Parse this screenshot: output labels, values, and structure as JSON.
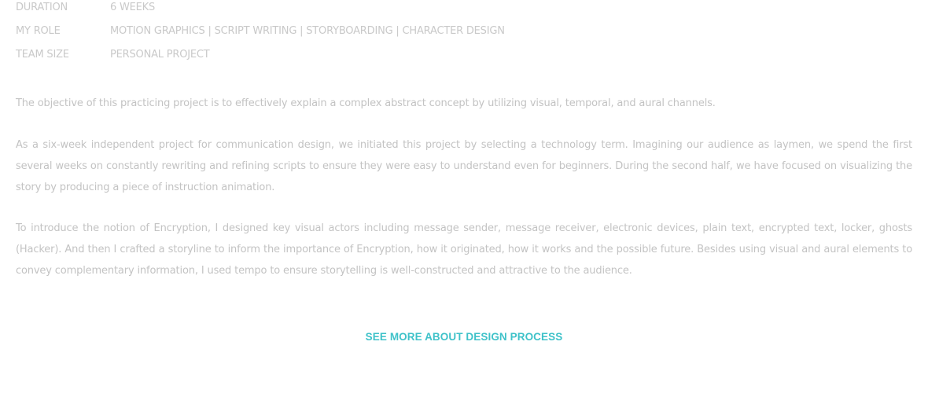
{
  "project_meta": [
    {
      "label": "DURATION",
      "value": "6 WEEKS"
    },
    {
      "label": "MY ROLE",
      "value": "MOTION GRAPHICS | SCRIPT WRITING | STORYBOARDING | CHARACTER DESIGN"
    },
    {
      "label": "TEAM SIZE",
      "value": "PERSONAL PROJECT"
    }
  ],
  "paragraphs": [
    "The objective of this practicing project is to effectively explain a complex abstract concept by utilizing visual, temporal, and aural channels.",
    "As a six-week independent project for communication design, we initiated this project by selecting a technology term. Imagining our audience as laymen, we spend the first several weeks on constantly rewriting and refining scripts to ensure they were easy to understand even for beginners. During the second half, we have focused on visualizing the story by producing a piece of instruction animation.",
    "To introduce the notion of Encryption, I designed key visual actors including message sender, message receiver, electronic devices, plain text, encrypted text, locker, ghosts (Hacker). And then I crafted a storyline to inform the importance of Encryption, how it originated, how it works and the possible future. Besides using visual and aural elements to convey complementary information, I used tempo to ensure storytelling is well-constructed and attractive to the audience."
  ],
  "cta": {
    "label": "SEE MORE ABOUT DESIGN PROCESS"
  },
  "colors": {
    "text": "#c3c3c3",
    "accent": "#3fc2c9",
    "background": "#ffffff"
  }
}
